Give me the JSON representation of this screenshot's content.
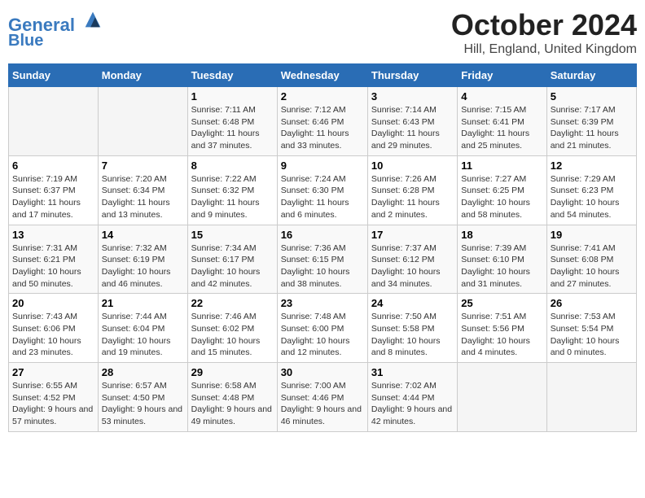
{
  "header": {
    "logo_line1": "General",
    "logo_line2": "Blue",
    "month_title": "October 2024",
    "location": "Hill, England, United Kingdom"
  },
  "days_of_week": [
    "Sunday",
    "Monday",
    "Tuesday",
    "Wednesday",
    "Thursday",
    "Friday",
    "Saturday"
  ],
  "weeks": [
    [
      {
        "num": "",
        "detail": ""
      },
      {
        "num": "",
        "detail": ""
      },
      {
        "num": "1",
        "detail": "Sunrise: 7:11 AM\nSunset: 6:48 PM\nDaylight: 11 hours and 37 minutes."
      },
      {
        "num": "2",
        "detail": "Sunrise: 7:12 AM\nSunset: 6:46 PM\nDaylight: 11 hours and 33 minutes."
      },
      {
        "num": "3",
        "detail": "Sunrise: 7:14 AM\nSunset: 6:43 PM\nDaylight: 11 hours and 29 minutes."
      },
      {
        "num": "4",
        "detail": "Sunrise: 7:15 AM\nSunset: 6:41 PM\nDaylight: 11 hours and 25 minutes."
      },
      {
        "num": "5",
        "detail": "Sunrise: 7:17 AM\nSunset: 6:39 PM\nDaylight: 11 hours and 21 minutes."
      }
    ],
    [
      {
        "num": "6",
        "detail": "Sunrise: 7:19 AM\nSunset: 6:37 PM\nDaylight: 11 hours and 17 minutes."
      },
      {
        "num": "7",
        "detail": "Sunrise: 7:20 AM\nSunset: 6:34 PM\nDaylight: 11 hours and 13 minutes."
      },
      {
        "num": "8",
        "detail": "Sunrise: 7:22 AM\nSunset: 6:32 PM\nDaylight: 11 hours and 9 minutes."
      },
      {
        "num": "9",
        "detail": "Sunrise: 7:24 AM\nSunset: 6:30 PM\nDaylight: 11 hours and 6 minutes."
      },
      {
        "num": "10",
        "detail": "Sunrise: 7:26 AM\nSunset: 6:28 PM\nDaylight: 11 hours and 2 minutes."
      },
      {
        "num": "11",
        "detail": "Sunrise: 7:27 AM\nSunset: 6:25 PM\nDaylight: 10 hours and 58 minutes."
      },
      {
        "num": "12",
        "detail": "Sunrise: 7:29 AM\nSunset: 6:23 PM\nDaylight: 10 hours and 54 minutes."
      }
    ],
    [
      {
        "num": "13",
        "detail": "Sunrise: 7:31 AM\nSunset: 6:21 PM\nDaylight: 10 hours and 50 minutes."
      },
      {
        "num": "14",
        "detail": "Sunrise: 7:32 AM\nSunset: 6:19 PM\nDaylight: 10 hours and 46 minutes."
      },
      {
        "num": "15",
        "detail": "Sunrise: 7:34 AM\nSunset: 6:17 PM\nDaylight: 10 hours and 42 minutes."
      },
      {
        "num": "16",
        "detail": "Sunrise: 7:36 AM\nSunset: 6:15 PM\nDaylight: 10 hours and 38 minutes."
      },
      {
        "num": "17",
        "detail": "Sunrise: 7:37 AM\nSunset: 6:12 PM\nDaylight: 10 hours and 34 minutes."
      },
      {
        "num": "18",
        "detail": "Sunrise: 7:39 AM\nSunset: 6:10 PM\nDaylight: 10 hours and 31 minutes."
      },
      {
        "num": "19",
        "detail": "Sunrise: 7:41 AM\nSunset: 6:08 PM\nDaylight: 10 hours and 27 minutes."
      }
    ],
    [
      {
        "num": "20",
        "detail": "Sunrise: 7:43 AM\nSunset: 6:06 PM\nDaylight: 10 hours and 23 minutes."
      },
      {
        "num": "21",
        "detail": "Sunrise: 7:44 AM\nSunset: 6:04 PM\nDaylight: 10 hours and 19 minutes."
      },
      {
        "num": "22",
        "detail": "Sunrise: 7:46 AM\nSunset: 6:02 PM\nDaylight: 10 hours and 15 minutes."
      },
      {
        "num": "23",
        "detail": "Sunrise: 7:48 AM\nSunset: 6:00 PM\nDaylight: 10 hours and 12 minutes."
      },
      {
        "num": "24",
        "detail": "Sunrise: 7:50 AM\nSunset: 5:58 PM\nDaylight: 10 hours and 8 minutes."
      },
      {
        "num": "25",
        "detail": "Sunrise: 7:51 AM\nSunset: 5:56 PM\nDaylight: 10 hours and 4 minutes."
      },
      {
        "num": "26",
        "detail": "Sunrise: 7:53 AM\nSunset: 5:54 PM\nDaylight: 10 hours and 0 minutes."
      }
    ],
    [
      {
        "num": "27",
        "detail": "Sunrise: 6:55 AM\nSunset: 4:52 PM\nDaylight: 9 hours and 57 minutes."
      },
      {
        "num": "28",
        "detail": "Sunrise: 6:57 AM\nSunset: 4:50 PM\nDaylight: 9 hours and 53 minutes."
      },
      {
        "num": "29",
        "detail": "Sunrise: 6:58 AM\nSunset: 4:48 PM\nDaylight: 9 hours and 49 minutes."
      },
      {
        "num": "30",
        "detail": "Sunrise: 7:00 AM\nSunset: 4:46 PM\nDaylight: 9 hours and 46 minutes."
      },
      {
        "num": "31",
        "detail": "Sunrise: 7:02 AM\nSunset: 4:44 PM\nDaylight: 9 hours and 42 minutes."
      },
      {
        "num": "",
        "detail": ""
      },
      {
        "num": "",
        "detail": ""
      }
    ]
  ]
}
